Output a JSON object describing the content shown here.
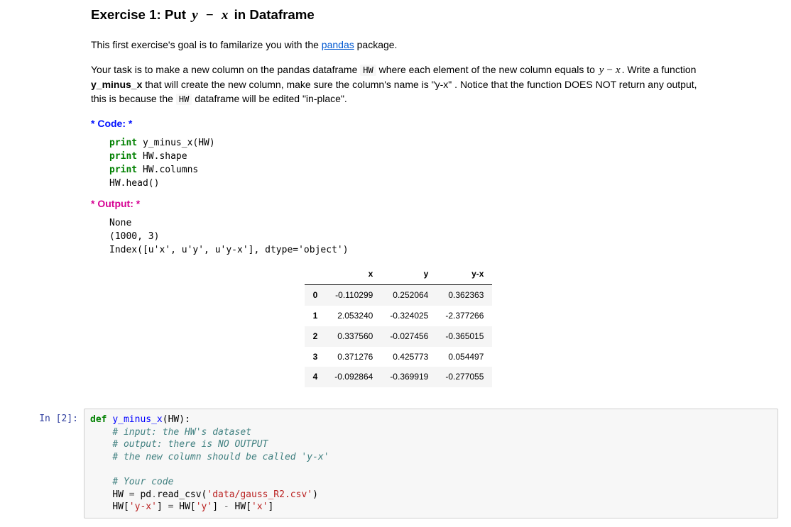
{
  "title": {
    "prefix": "Exercise 1: Put ",
    "mathA": "y",
    "mathMinus": "−",
    "mathB": "x",
    "suffix": " in Dataframe"
  },
  "intro": {
    "p1a": "This first exercise's goal is to familarize you with the ",
    "pandas_text": "pandas",
    "p1b": " package.",
    "p2a": "Your task is to make a new column on the pandas dataframe ",
    "hw_code": "HW",
    "p2b": " where each element of the new column equals to ",
    "m_y": "y",
    "m_minus": "−",
    "m_x": "x",
    "p2c": ". Write a function ",
    "fn_name": "y_minus_x",
    "p2d": " that will create the new column, make sure the column's name is \"y-x\" . Notice that the function DOES NOT return any output, this is because the ",
    "hw_code2": "HW",
    "p2e": " dataframe will be edited \"in-place\"."
  },
  "labels": {
    "code": "* Code: *",
    "output": "* Output: *"
  },
  "codeblock": {
    "kw": "print",
    "l1": " y_minus_x(HW)",
    "l2": " HW.shape",
    "l3": " HW.columns",
    "l4": "HW.head()"
  },
  "outblock": {
    "l1": "None",
    "l2": "(1000, 3)",
    "l3": "Index([u'x', u'y', u'y-x'], dtype='object')"
  },
  "df": {
    "columns": [
      "x",
      "y",
      "y-x"
    ],
    "index": [
      "0",
      "1",
      "2",
      "3",
      "4"
    ],
    "rows": [
      [
        "-0.110299",
        "0.252064",
        "0.362363"
      ],
      [
        "2.053240",
        "-0.324025",
        "-2.377266"
      ],
      [
        "0.337560",
        "-0.027456",
        "-0.365015"
      ],
      [
        "0.371276",
        "0.425773",
        "0.054497"
      ],
      [
        "-0.092864",
        "-0.369919",
        "-0.277055"
      ]
    ]
  },
  "cell2": {
    "prompt": "In [2]:",
    "tokens": {
      "def": "def",
      "fn": "y_minus_x",
      "sig_rest": "(HW):",
      "c1": "# input: the HW's dataset",
      "c2": "# output: there is NO OUTPUT",
      "c3": "# the new column should be called 'y-x'",
      "c4": "# Your code",
      "l_assign1a": "HW ",
      "op_eq": "=",
      "l_assign1b": " pd",
      "op_dot": ".",
      "l_read": "read_csv(",
      "str1": "'data/gauss_R2.csv'",
      "l_close": ")",
      "l2a": "HW[",
      "str_yx": "'y-x'",
      "l2b": "] ",
      "l2c": " HW[",
      "str_y": "'y'",
      "l2d": "] ",
      "op_minus": "-",
      "l2e": " HW[",
      "str_x": "'x'",
      "l2f": "]"
    }
  }
}
